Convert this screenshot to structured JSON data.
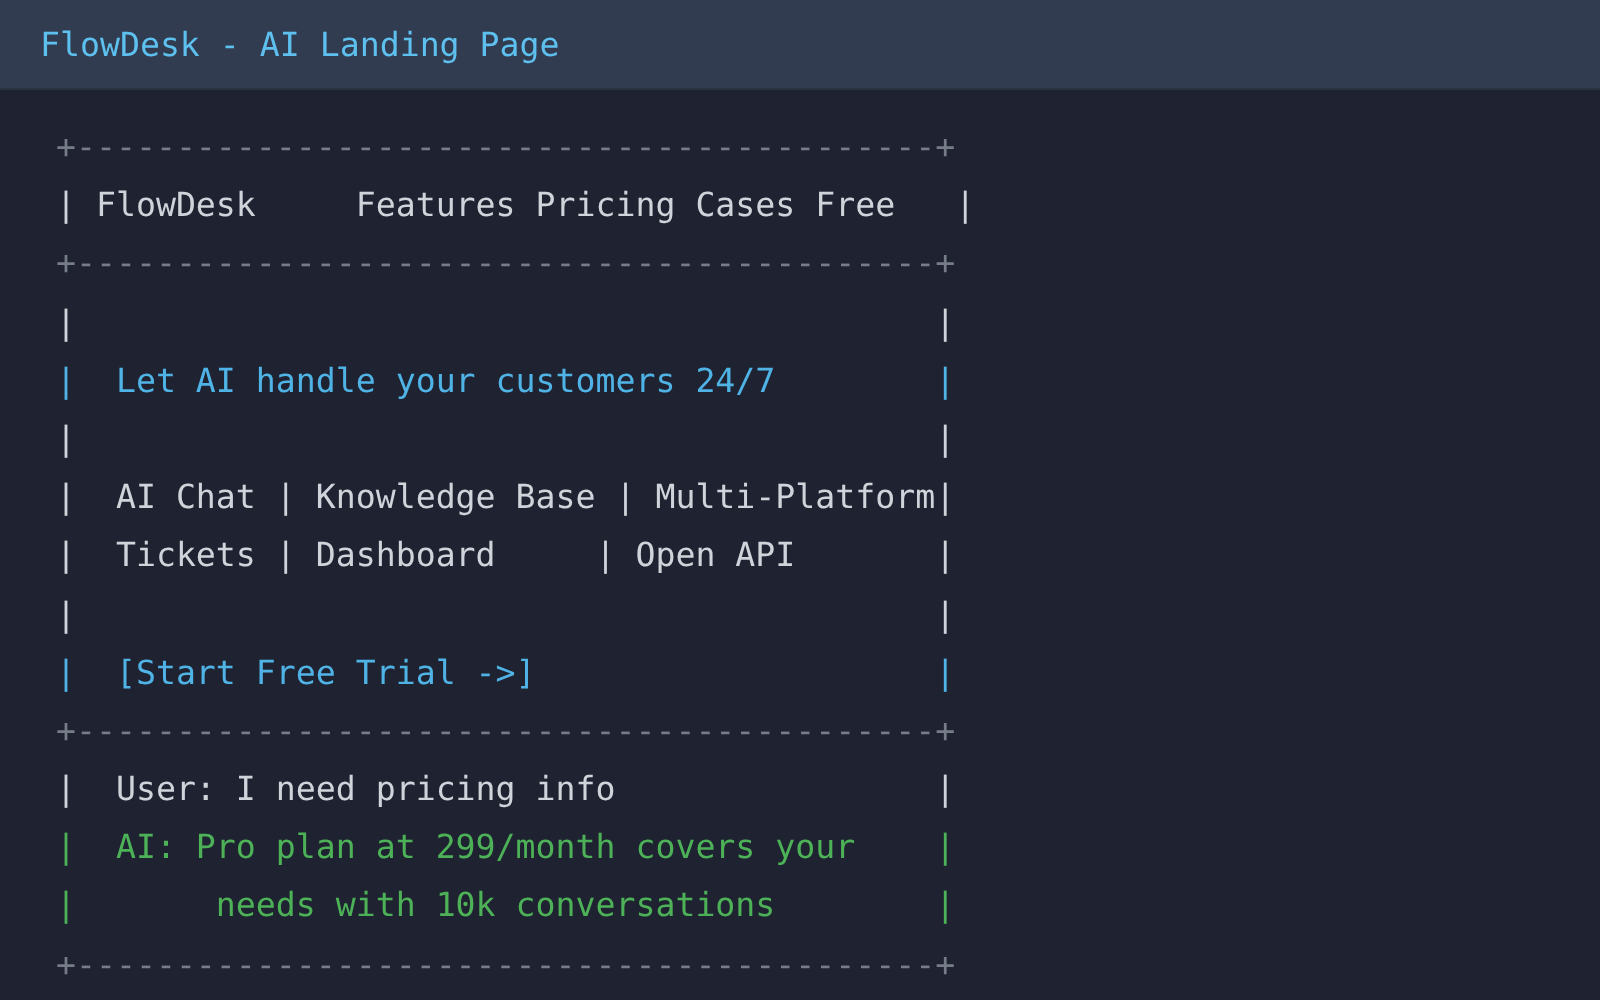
{
  "window": {
    "title": "FlowDesk - AI Landing Page"
  },
  "lines": [
    {
      "kind": "border",
      "text": "+-------------------------------------------+"
    },
    {
      "kind": "plain",
      "text": "| FlowDesk     Features Pricing Cases Free   |"
    },
    {
      "kind": "border",
      "text": "+-------------------------------------------+"
    },
    {
      "kind": "plain",
      "text": "|                                           |"
    },
    {
      "kind": "accent",
      "text": "|  Let AI handle your customers 24/7        |"
    },
    {
      "kind": "plain",
      "text": "|                                           |"
    },
    {
      "kind": "plain",
      "text": "|  AI Chat | Knowledge Base | Multi-Platform|"
    },
    {
      "kind": "plain",
      "text": "|  Tickets | Dashboard     | Open API       |"
    },
    {
      "kind": "plain",
      "text": "|                                           |"
    },
    {
      "kind": "accent",
      "text": "|  [Start Free Trial ->]                    |"
    },
    {
      "kind": "border",
      "text": "+-------------------------------------------+"
    },
    {
      "kind": "plain",
      "text": "|  User: I need pricing info                |"
    },
    {
      "kind": "ai",
      "text": "|  AI: Pro plan at 299/month covers your    |"
    },
    {
      "kind": "ai",
      "text": "|       needs with 10k conversations        |"
    },
    {
      "kind": "border",
      "text": "+-------------------------------------------+"
    }
  ]
}
